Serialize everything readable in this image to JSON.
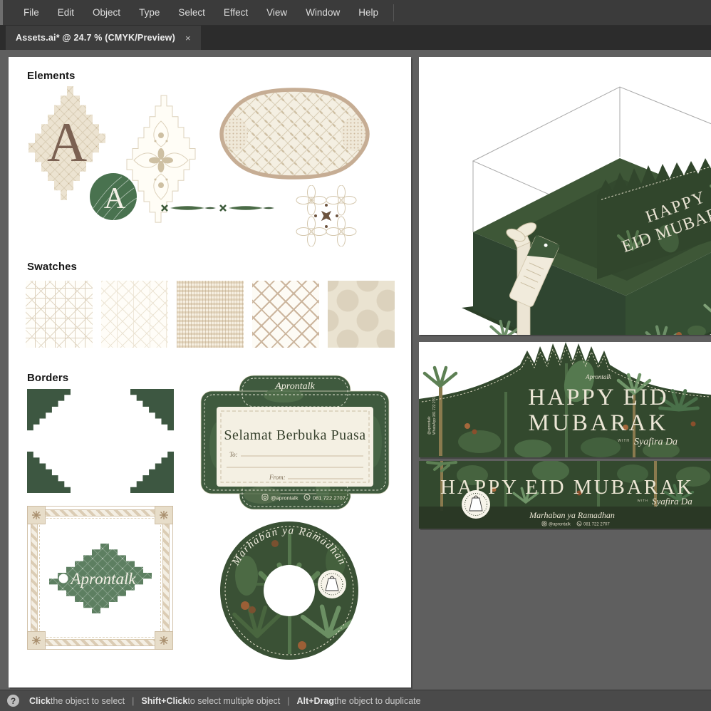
{
  "app": {
    "menu": [
      "File",
      "Edit",
      "Object",
      "Type",
      "Select",
      "Effect",
      "View",
      "Window",
      "Help"
    ],
    "tab_title": "Assets.ai* @ 24.7 % (CMYK/Preview)",
    "tab_close": "×",
    "status": {
      "icon": "?",
      "seg1_bold": "Click",
      "seg1_rest": " the object to select",
      "sep1": "|",
      "seg2_bold": "Shift+Click",
      "seg2_rest": " to select multiple object",
      "sep2": "|",
      "seg3_bold": "Alt+Drag",
      "seg3_rest": " the object to duplicate"
    }
  },
  "assets": {
    "headings": {
      "elements": "Elements",
      "swatches": "Swatches",
      "borders": "Borders"
    },
    "monogram": "A",
    "label_card": {
      "brand": "Aprontalk",
      "title": "Selamat Berbuka Puasa",
      "to": "To:",
      "from": "From:",
      "instagram": "@aprontalk",
      "phone": "081 722 2707"
    },
    "gift_tag": {
      "brand": "Aprontalk"
    },
    "sticker": {
      "script": "Marhaban ya Ramadhan"
    }
  },
  "box_mockup": {
    "card_line1": "HAPPY",
    "card_line2": "EID MUBARAK"
  },
  "eid_card": {
    "brand": "Aprontalk",
    "line1": "HAPPY EID",
    "line2": "MUBARAK",
    "with": "WITH",
    "signature": "Syafira Da",
    "side_line1": "@aprontalk",
    "side_line2": "WhatsApp 081 722 2707"
  },
  "eid_banner": {
    "title": "HAPPY EID MUBARAK",
    "with": "WITH",
    "signature": "Syafira Da",
    "script": "Marhaban ya Ramadhan",
    "instagram": "@aprontalk",
    "phone": "081 722 2707"
  },
  "colors": {
    "green_dark": "#2e4227",
    "green_mid": "#3a5433",
    "green_tag": "#5d7f61",
    "cream": "#efe9d9",
    "tan": "#c6ad94",
    "ui_dark": "#3b3b3b",
    "pasteboard": "#5f5f5f"
  }
}
